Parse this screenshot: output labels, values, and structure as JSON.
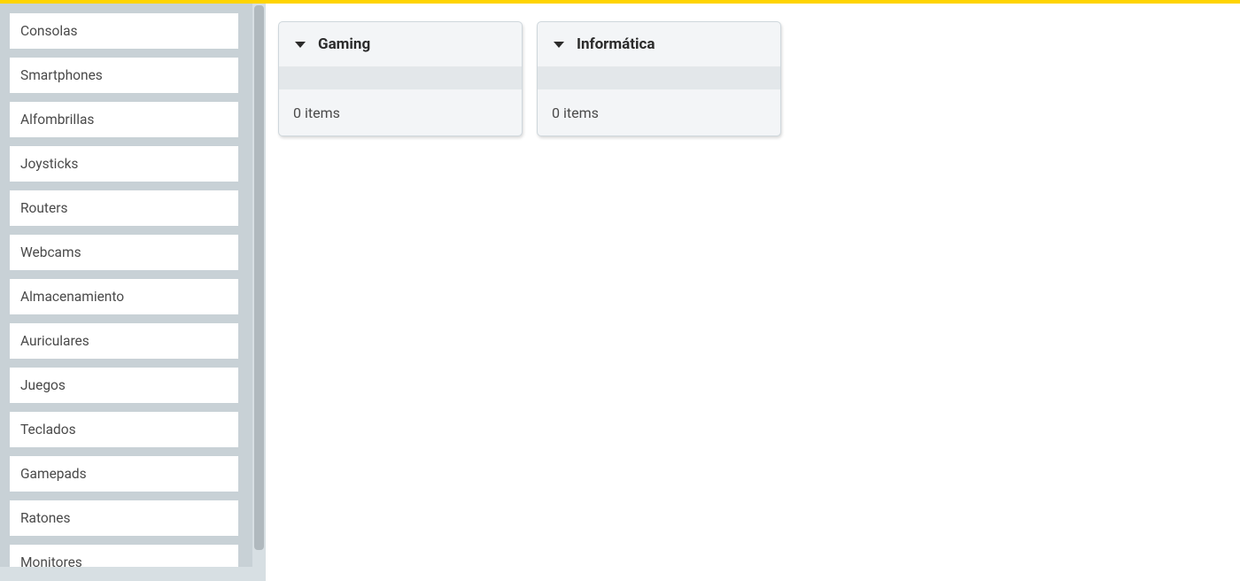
{
  "sidebar": {
    "items": [
      {
        "label": "Consolas"
      },
      {
        "label": "Smartphones"
      },
      {
        "label": "Alfombrillas"
      },
      {
        "label": "Joysticks"
      },
      {
        "label": "Routers"
      },
      {
        "label": "Webcams"
      },
      {
        "label": "Almacenamiento"
      },
      {
        "label": "Auriculares"
      },
      {
        "label": "Juegos"
      },
      {
        "label": "Teclados"
      },
      {
        "label": "Gamepads"
      },
      {
        "label": "Ratones"
      },
      {
        "label": "Monitores"
      }
    ]
  },
  "main": {
    "cards": [
      {
        "title": "Gaming",
        "items_text": "0 items"
      },
      {
        "title": "Informática",
        "items_text": "0 items"
      }
    ]
  },
  "colors": {
    "accent": "#ffd400",
    "sidebar_bg": "#c8d1d6",
    "card_bg": "#f3f5f7",
    "strip": "#e3e7ea",
    "text": "#4a4a4a"
  }
}
